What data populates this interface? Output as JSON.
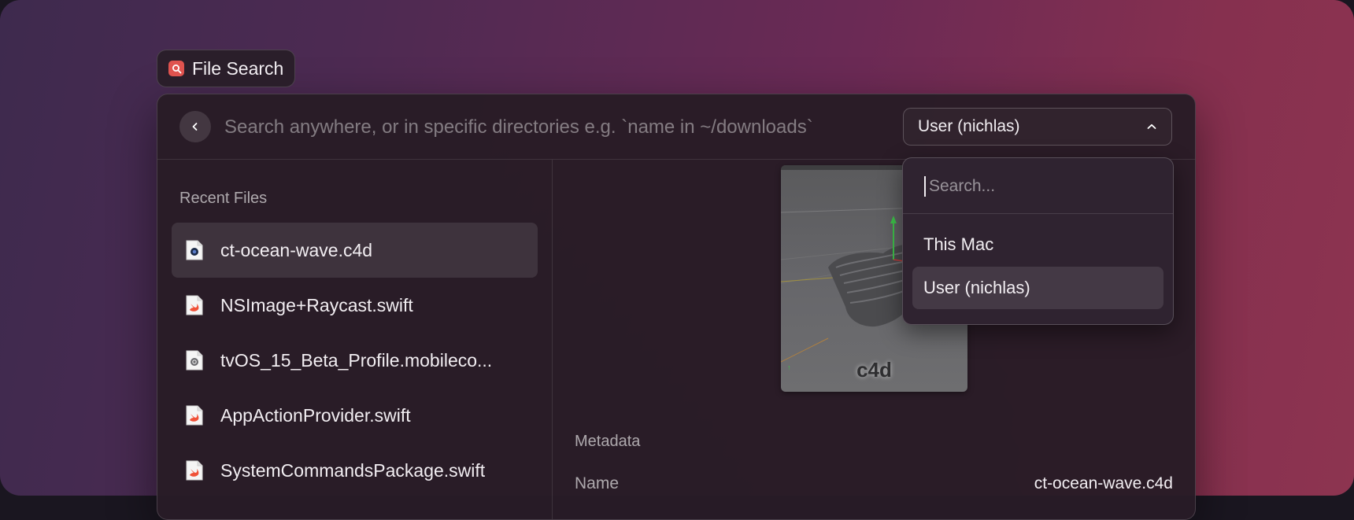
{
  "app": {
    "title": "File Search"
  },
  "search": {
    "placeholder": "Search anywhere, or in specific directories e.g. `name in ~/downloads`"
  },
  "scope": {
    "selected": "User (nichlas)",
    "dropdown": {
      "placeholder": "Search...",
      "options": [
        "This Mac",
        "User (nichlas)"
      ],
      "selected_index": 1
    }
  },
  "recent": {
    "title": "Recent Files",
    "files": [
      {
        "name": "ct-ocean-wave.c4d",
        "icon": "c4d-file-icon",
        "selected": true
      },
      {
        "name": "NSImage+Raycast.swift",
        "icon": "swift-file-icon"
      },
      {
        "name": "tvOS_15_Beta_Profile.mobileco...",
        "icon": "mobileconfig-file-icon"
      },
      {
        "name": "AppActionProvider.swift",
        "icon": "swift-file-icon"
      },
      {
        "name": "SystemCommandsPackage.swift",
        "icon": "swift-file-icon"
      }
    ]
  },
  "preview": {
    "caption": "c4d"
  },
  "metadata": {
    "title": "Metadata",
    "rows": [
      {
        "key": "Name",
        "value": "ct-ocean-wave.c4d"
      }
    ]
  },
  "colors": {
    "accent_icon": "#e0534f",
    "swift": "#f05138"
  }
}
